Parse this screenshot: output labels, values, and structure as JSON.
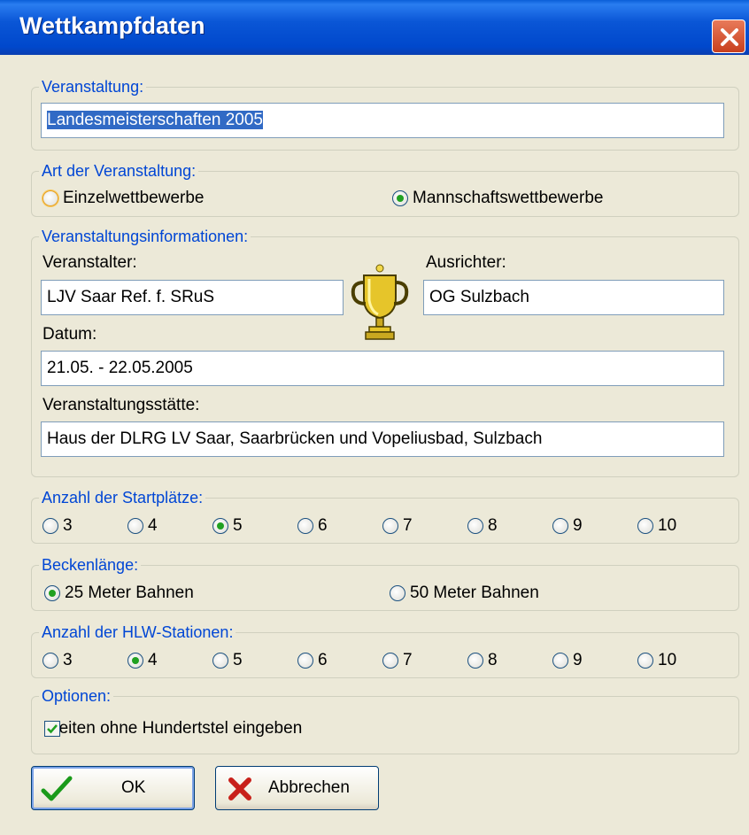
{
  "window": {
    "title": "Wettkampfdaten"
  },
  "veranstaltung": {
    "legend": "Veranstaltung:",
    "value": "Landesmeisterschaften 2005"
  },
  "art": {
    "legend": "Art der Veranstaltung:",
    "options": [
      "Einzelwettbewerbe",
      "Mannschaftswettbewerbe"
    ],
    "selected": "Mannschaftswettbewerbe"
  },
  "info": {
    "legend": "Veranstaltungsinformationen:",
    "veranstalter_label": "Veranstalter:",
    "veranstalter_value": "LJV Saar Ref. f. SRuS",
    "ausrichter_label": "Ausrichter:",
    "ausrichter_value": "OG Sulzbach",
    "datum_label": "Datum:",
    "datum_value": "21.05. - 22.05.2005",
    "staette_label": "Veranstaltungsstätte:",
    "staette_value": "Haus der DLRG LV Saar, Saarbrücken und Vopeliusbad, Sulzbach"
  },
  "startplaetze": {
    "legend": "Anzahl der Startplätze:",
    "options": [
      "3",
      "4",
      "5",
      "6",
      "7",
      "8",
      "9",
      "10"
    ],
    "selected": "5"
  },
  "becken": {
    "legend": "Beckenlänge:",
    "options": [
      "25 Meter Bahnen",
      "50 Meter Bahnen"
    ],
    "selected": "25 Meter Bahnen"
  },
  "hlw": {
    "legend": "Anzahl der HLW-Stationen:",
    "options": [
      "3",
      "4",
      "5",
      "6",
      "7",
      "8",
      "9",
      "10"
    ],
    "selected": "4"
  },
  "optionen": {
    "legend": "Optionen:",
    "checkbox_label": "Zeiten ohne Hundertstel eingeben",
    "checked": true
  },
  "buttons": {
    "ok": "OK",
    "cancel": "Abbrechen"
  },
  "colors": {
    "titlebar": "#0a56d6",
    "dialog": "#ece9d8",
    "legend": "#0046d5",
    "radio_dot": "#21a121",
    "selection": "#316ac5"
  },
  "icons": {
    "close": "close-icon",
    "trophy": "trophy-icon",
    "ok": "checkmark-icon",
    "cancel": "x-icon"
  }
}
